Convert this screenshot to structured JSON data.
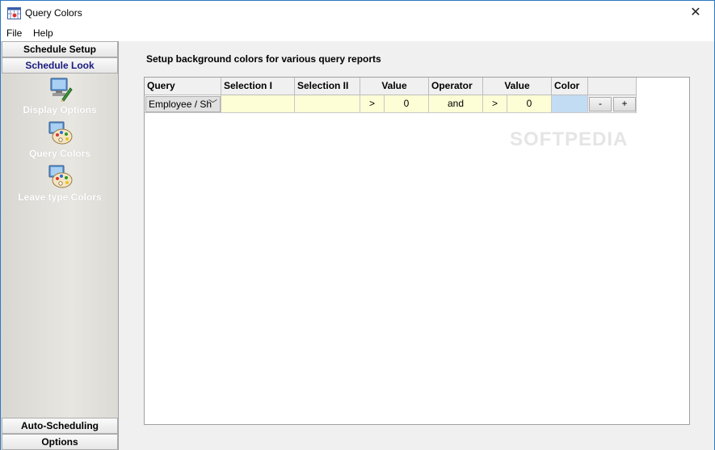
{
  "window": {
    "title": "Query Colors"
  },
  "menu": {
    "file": "File",
    "help": "Help"
  },
  "sidebar": {
    "top_buttons": [
      "Schedule Setup",
      "Schedule Look"
    ],
    "items": [
      {
        "label": "Display Options",
        "icon": "display-options-icon"
      },
      {
        "label": "Query Colors",
        "icon": "query-colors-icon"
      },
      {
        "label": "Leave type Colors",
        "icon": "leave-colors-icon"
      }
    ],
    "bottom_buttons": [
      "Auto-Scheduling",
      "Options"
    ]
  },
  "main": {
    "heading": "Setup background colors for various query reports",
    "columns": [
      "Query",
      "Selection I",
      "Selection II",
      "Value",
      "Operator",
      "Value",
      "Color"
    ],
    "row": {
      "query": "Employee / Sh",
      "selection_1": "",
      "selection_2": "",
      "op1": ">",
      "value1": "0",
      "operator": "and",
      "op2": ">",
      "value2": "0",
      "color": "#c2dcf4",
      "minus": "-",
      "plus": "+"
    }
  },
  "watermark": "SOFTPEDIA"
}
